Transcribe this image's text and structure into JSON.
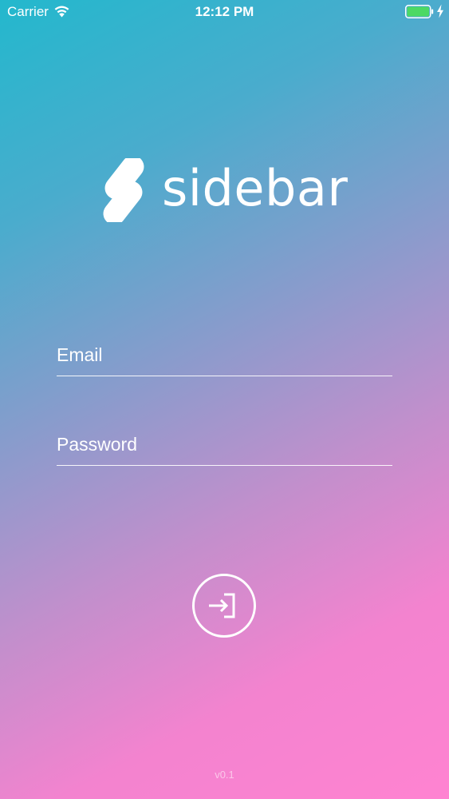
{
  "status_bar": {
    "carrier": "Carrier",
    "time": "12:12 PM",
    "battery_level": 1.0,
    "battery_color": "#4cd964",
    "wifi_icon": "wifi-icon",
    "charging_icon": "bolt-icon"
  },
  "logo": {
    "wordmark": "sidebar",
    "mark_icon": "sidebar-s-logo"
  },
  "form": {
    "email_placeholder": "Email",
    "email_value": "",
    "password_placeholder": "Password",
    "password_value": ""
  },
  "login_button": {
    "icon": "sign-in-icon"
  },
  "footer": {
    "version": "v0.1"
  },
  "colors": {
    "gradient_start": "#23b8cd",
    "gradient_end": "#ff83d1",
    "foreground": "#ffffff"
  }
}
